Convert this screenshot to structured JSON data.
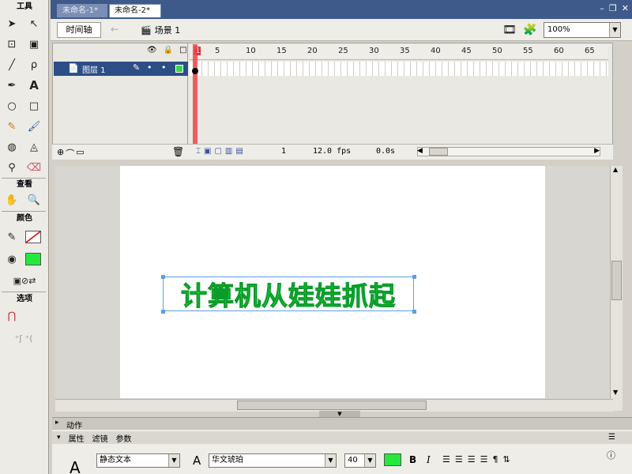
{
  "tools": {
    "section_tools": "工具",
    "section_view": "查看",
    "section_colors": "颜色",
    "section_options": "选项"
  },
  "tabs": [
    {
      "label": "未命名-1*"
    },
    {
      "label": "未命名-2*"
    }
  ],
  "window_controls": {
    "minimize": "–",
    "restore": "❐",
    "close": "✕"
  },
  "editbar": {
    "timeline_button": "时间轴",
    "back_arrow": "←",
    "scene_label": "场景 1",
    "zoom_value": "100%"
  },
  "timeline": {
    "frame_numbers": [
      "1",
      "5",
      "10",
      "15",
      "20",
      "25",
      "30",
      "35",
      "40",
      "45",
      "50",
      "55",
      "60",
      "65"
    ],
    "layer_name": "图层 1",
    "current_frame": "1",
    "frame_rate": "12.0 fps",
    "elapsed_time": "0.0s"
  },
  "stage": {
    "text": "计算机从娃娃抓起",
    "text_color": "#24e83c"
  },
  "panels": {
    "actions_label": "动作",
    "props_tabs": [
      "属性",
      "滤镜",
      "参数"
    ],
    "text_type": "静态文本",
    "font_name": "华文琥珀",
    "font_size": "40",
    "fill_color": "#24e83c",
    "bold": "B",
    "italic": "I"
  }
}
